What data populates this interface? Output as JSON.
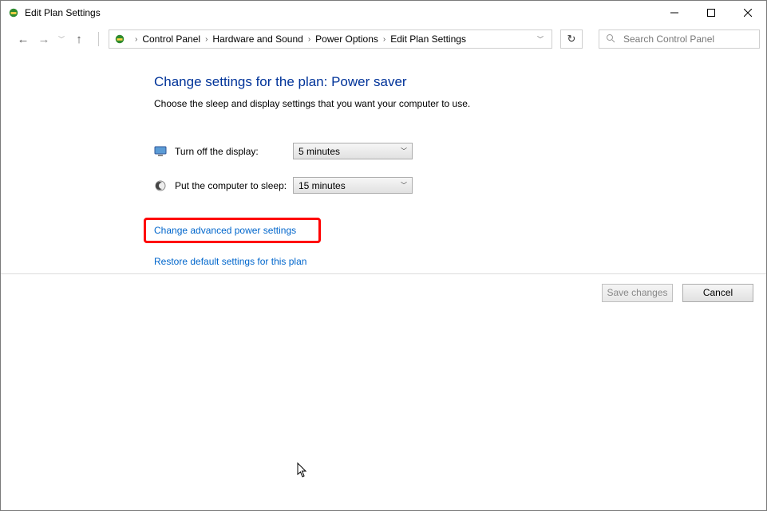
{
  "window": {
    "title": "Edit Plan Settings"
  },
  "breadcrumbs": {
    "items": [
      "Control Panel",
      "Hardware and Sound",
      "Power Options",
      "Edit Plan Settings"
    ]
  },
  "search": {
    "placeholder": "Search Control Panel"
  },
  "page": {
    "heading": "Change settings for the plan: Power saver",
    "description": "Choose the sleep and display settings that you want your computer to use.",
    "display_row": {
      "label": "Turn off the display:",
      "value": "5 minutes"
    },
    "sleep_row": {
      "label": "Put the computer to sleep:",
      "value": "15 minutes"
    },
    "link_advanced": "Change advanced power settings",
    "link_restore": "Restore default settings for this plan"
  },
  "buttons": {
    "save": "Save changes",
    "cancel": "Cancel"
  }
}
